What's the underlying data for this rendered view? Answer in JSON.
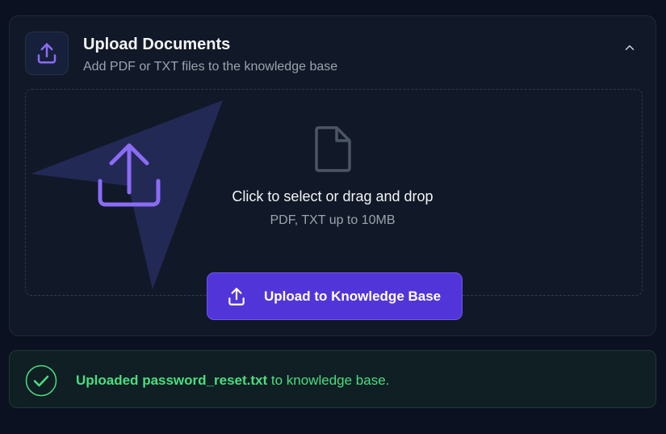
{
  "panel": {
    "title": "Upload Documents",
    "subtitle": "Add PDF or TXT files to the knowledge base",
    "header_icon": "upload-icon",
    "collapse_icon": "chevron-up-icon"
  },
  "dropzone": {
    "title": "Click to select or drag and drop",
    "hint": "PDF, TXT up to 10MB",
    "icon": "file-icon"
  },
  "upload_button": {
    "label": "Upload to Knowledge Base",
    "icon": "upload-icon"
  },
  "status": {
    "prefix": "Uploaded",
    "filename": "password_reset.txt",
    "suffix": "to knowledge base.",
    "icon": "check-circle-icon"
  },
  "colors": {
    "accent": "#5235d8",
    "success": "#4ade80",
    "background": "#0b1120"
  }
}
